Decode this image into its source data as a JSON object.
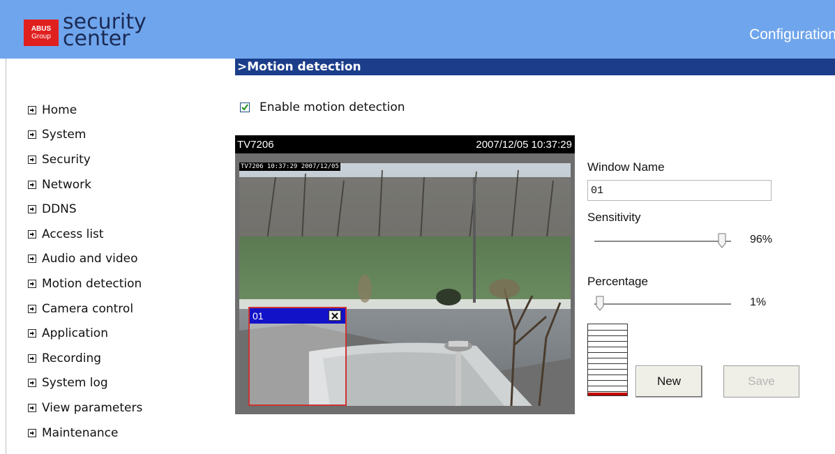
{
  "header": {
    "logo_badge_line1": "ABUS",
    "logo_badge_line2": "Group",
    "logo_text_line1": "security",
    "logo_text_line2": "center",
    "title": "Configuration"
  },
  "sidebar": {
    "items": [
      {
        "label": "Home"
      },
      {
        "label": "System"
      },
      {
        "label": "Security"
      },
      {
        "label": "Network"
      },
      {
        "label": "DDNS"
      },
      {
        "label": "Access list"
      },
      {
        "label": "Audio and video"
      },
      {
        "label": "Motion detection"
      },
      {
        "label": "Camera control"
      },
      {
        "label": "Application"
      },
      {
        "label": "Recording"
      },
      {
        "label": "System log"
      },
      {
        "label": "View parameters"
      },
      {
        "label": "Maintenance"
      }
    ]
  },
  "section": {
    "title": ">Motion detection"
  },
  "enable": {
    "label": "Enable motion detection",
    "checked": true
  },
  "camera": {
    "name": "TV7206",
    "timestamp": "2007/12/05 10:37:29",
    "osd_text": "TV7206 10:37:29 2007/12/05"
  },
  "motion_window": {
    "name": "01",
    "close_symbol": "✕"
  },
  "panel": {
    "window_name_label": "Window Name",
    "window_name_value": "01",
    "sensitivity_label": "Sensitivity",
    "sensitivity_value": "96%",
    "sensitivity_level": 0.96,
    "percentage_label": "Percentage",
    "percentage_value": "1%",
    "percentage_level": 0.01,
    "new_button": "New",
    "save_button": "Save"
  },
  "colors": {
    "header_bg": "#6fa5ec",
    "section_bar": "#1b3d8a",
    "logo_red": "#e01f1f",
    "motion_window_title": "#1212c8",
    "motion_window_border": "#cc3333",
    "level_fill": "#c40000"
  },
  "icons": {
    "nav_item": "arrow-right-box-icon",
    "checkbox": "checkmark-icon",
    "close": "close-icon"
  }
}
